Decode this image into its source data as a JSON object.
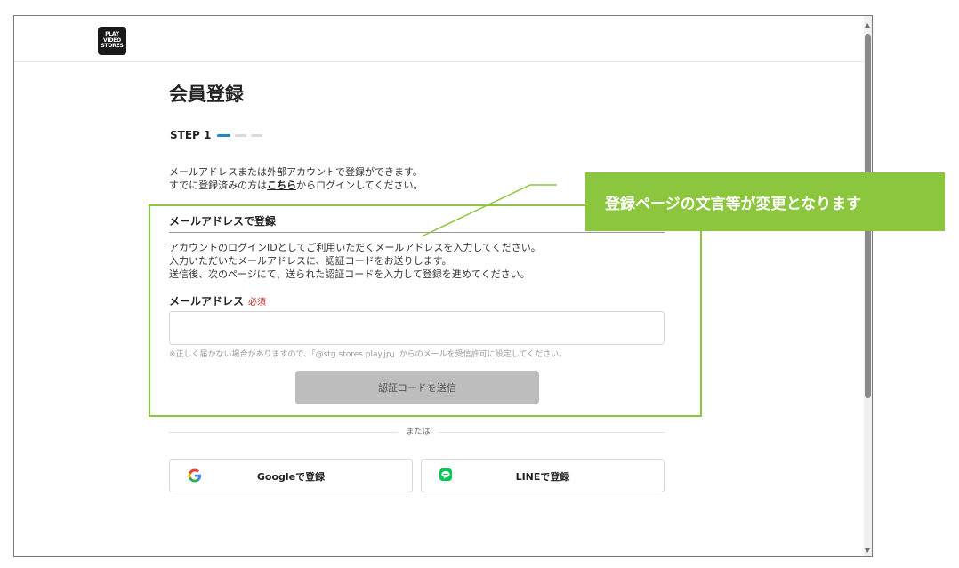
{
  "logo_text": [
    "PLAY",
    "VIDEO",
    "STORES"
  ],
  "page_title": "会員登録",
  "step_label": "STEP 1",
  "intro": {
    "line1": "メールアドレスまたは外部アカウントで登録ができます。",
    "line2_prefix": "すでに登録済みの方は",
    "line2_link": "こちら",
    "line2_suffix": "からログインしてください。"
  },
  "email_section": {
    "heading": "メールアドレスで登録",
    "desc_line1": "アカウントのログインIDとしてご利用いただくメールアドレスを入力してください。",
    "desc_line2": "入力いただいたメールアドレスに、認証コードをお送りします。",
    "desc_line3": "送信後、次のページにて、送られた認証コードを入力して登録を進めてください。",
    "field_label": "メールアドレス",
    "required_badge": "必須",
    "input_value": "",
    "input_placeholder": "",
    "note": "※正しく届かない場合がありますので、「@stg.stores.play.jp」からのメールを受信許可に設定してください。",
    "send_button": "認証コードを送信"
  },
  "or_text": "または",
  "social": {
    "google_label": "Googleで登録",
    "line_label": "LINEで登録"
  },
  "callout_text": "登録ページの文言等が変更となります",
  "colors": {
    "accent_green": "#8cc63f",
    "step_blue": "#1e87c8",
    "required_red": "#d6322b",
    "disabled_button": "#bdbdbd",
    "line_green": "#06c755"
  }
}
